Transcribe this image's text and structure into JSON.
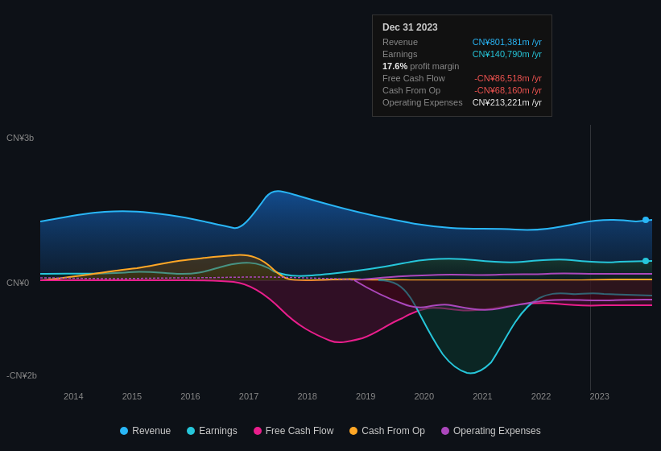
{
  "tooltip": {
    "date": "Dec 31 2023",
    "rows": [
      {
        "label": "Revenue",
        "value": "CN¥801,381m /yr",
        "color": "blue"
      },
      {
        "label": "Earnings",
        "value": "CN¥140,790m /yr",
        "color": "green"
      },
      {
        "label": "profit_margin",
        "pct": "17.6%",
        "text": "profit margin"
      },
      {
        "label": "Free Cash Flow",
        "value": "-CN¥86,518m /yr",
        "color": "red"
      },
      {
        "label": "Cash From Op",
        "value": "-CN¥68,160m /yr",
        "color": "red"
      },
      {
        "label": "Operating Expenses",
        "value": "CN¥213,221m /yr",
        "color": "white"
      }
    ]
  },
  "y_labels": {
    "top": "CN¥3b",
    "mid": "CN¥0",
    "bot": "-CN¥2b"
  },
  "x_labels": [
    "2014",
    "2015",
    "2016",
    "2017",
    "2018",
    "2019",
    "2020",
    "2021",
    "2022",
    "2023"
  ],
  "legend": [
    {
      "label": "Revenue",
      "color": "#29b6f6"
    },
    {
      "label": "Earnings",
      "color": "#26c6da"
    },
    {
      "label": "Free Cash Flow",
      "color": "#e91e8c"
    },
    {
      "label": "Cash From Op",
      "color": "#ffa726"
    },
    {
      "label": "Operating Expenses",
      "color": "#ab47bc"
    }
  ]
}
